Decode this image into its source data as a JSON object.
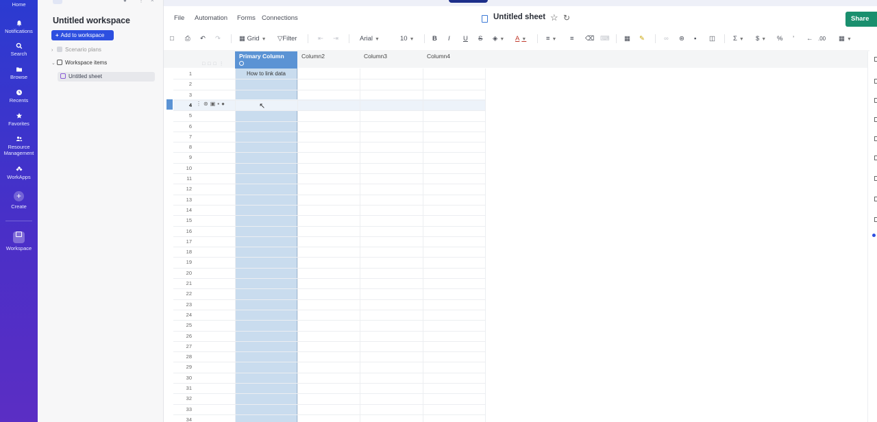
{
  "rail": {
    "items": [
      {
        "label": "Home",
        "icon": "home-icon"
      },
      {
        "label": "Notifications",
        "icon": "bell-icon"
      },
      {
        "label": "Search",
        "icon": "search-icon"
      },
      {
        "label": "Browse",
        "icon": "folder-icon"
      },
      {
        "label": "Recents",
        "icon": "clock-icon"
      },
      {
        "label": "Favorites",
        "icon": "star-icon"
      },
      {
        "label": "Resource Management",
        "icon": "people-icon"
      },
      {
        "label": "WorkApps",
        "icon": "workapps-icon"
      }
    ],
    "create_label": "Create",
    "workspace_label": "Workspace"
  },
  "panel": {
    "title": "Untitled workspace",
    "add_button": "Add to workspace",
    "tree": {
      "scenario_plans": "Scenario plans",
      "workspace_items": "Workspace items",
      "untitled_sheet": "Untitled sheet"
    }
  },
  "menubar": {
    "file": "File",
    "automation": "Automation",
    "forms": "Forms",
    "connections": "Connections",
    "sheet_title": "Untitled sheet",
    "share": "Share"
  },
  "toolbar": {
    "view": "Grid",
    "filter": "Filter",
    "font": "Arial",
    "font_size": "10",
    "currency": "$",
    "percent": "%",
    "decimal": ".00"
  },
  "grid": {
    "columns": [
      "Primary Column",
      "Column2",
      "Column3",
      "Column4"
    ],
    "rows": [
      "1",
      "2",
      "3",
      "4",
      "5",
      "6",
      "7",
      "8",
      "9",
      "10",
      "11",
      "12",
      "13",
      "14",
      "15",
      "16",
      "17",
      "18",
      "19",
      "20",
      "21",
      "22",
      "23",
      "24",
      "25",
      "26",
      "27",
      "28",
      "29",
      "30",
      "31",
      "32",
      "33",
      "34"
    ],
    "cell_r1c1": "How to link data",
    "selected_row": "4"
  },
  "colors": {
    "accent": "#2d4fe0",
    "share": "#1a8f6e",
    "primary_header": "#5b93d4",
    "primary_fill": "#c9dcee"
  }
}
